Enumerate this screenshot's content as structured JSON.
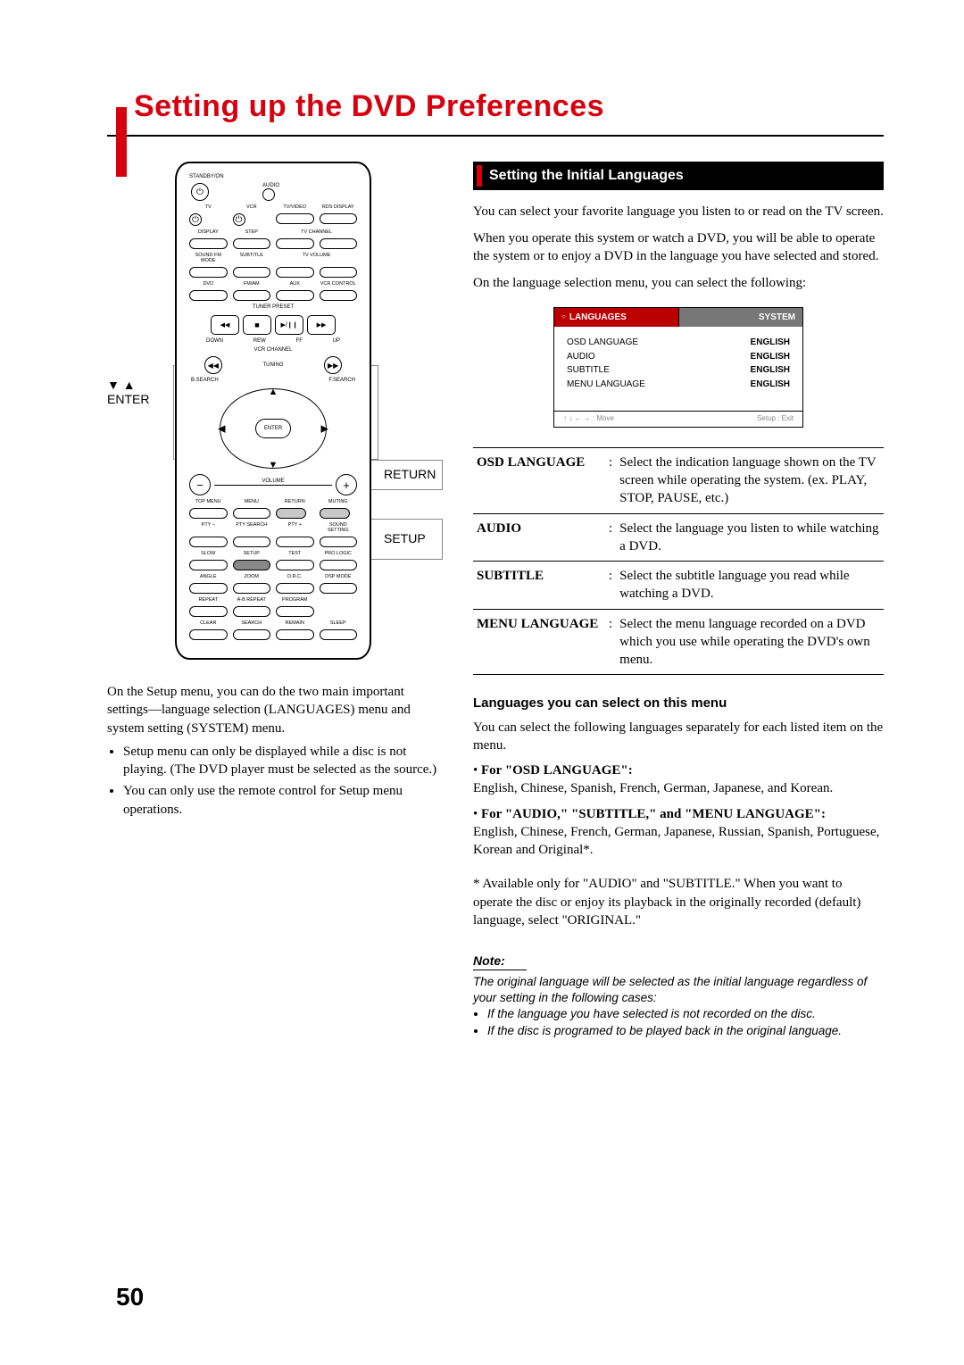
{
  "title": "Setting up the DVD Preferences",
  "page_number": "50",
  "remote_callouts": {
    "enter_arrows": "▼ ▲",
    "enter": "ENTER",
    "return": "RETURN",
    "setup": "SETUP"
  },
  "remote_labels": {
    "standby": "STANDBY/ON",
    "audio": "AUDIO",
    "row1": [
      "TV",
      "VCR",
      "TV/VIDEO",
      "RDS DISPLAY"
    ],
    "row2": [
      "DISPLAY",
      "STEP",
      "TV CHANNEL"
    ],
    "row3": [
      "SOUND FM MODE",
      "SUBTITLE",
      "TV VOLUME"
    ],
    "row4": [
      "DVD",
      "FM/AM",
      "AUX",
      "VCR CONTROL"
    ],
    "tuner": "TUNER PRESET",
    "down": "DOWN",
    "up": "UP",
    "rew": "REW",
    "ff": "FF",
    "vcrch": "VCR CHANNEL",
    "tuning": "TUNING",
    "bsearch": "B.SEARCH",
    "fsearch": "F.SEARCH",
    "enter": "ENTER",
    "volume": "VOLUME",
    "menu_row": [
      "TOP MENU",
      "MENU",
      "RETURN",
      "MUTING"
    ],
    "row5": [
      "PTY –",
      "PTY SEARCH",
      "PTY +",
      "SOUND SETTING"
    ],
    "row6": [
      "SLOW",
      "SETUP",
      "TEST",
      "PRO LOGIC"
    ],
    "row7": [
      "ANGLE",
      "ZOOM",
      "D.R.C.",
      "DSP MODE"
    ],
    "row8": [
      "REPEAT",
      "A-B REPEAT",
      "PROGRAM",
      ""
    ],
    "row9": [
      "CLEAR",
      "SEARCH",
      "REMAIN",
      "SLEEP"
    ]
  },
  "left_text": {
    "p1": "On the Setup menu, you can do the two main important settings—language selection (LANGUAGES) menu and system setting (SYSTEM) menu.",
    "b1": "Setup menu can only be displayed while a disc is not playing. (The DVD player must be selected as the source.)",
    "b2": "You can only use the remote control for Setup menu operations."
  },
  "section_heading": "Setting the Initial Languages",
  "r_p1": "You can select your favorite language you listen to or read on the TV screen.",
  "r_p2": "When you operate this system or watch a DVD, you will be able to operate the system or to enjoy a DVD in the language you have selected and stored.",
  "r_p3": "On the language selection menu, you can select the following:",
  "osd": {
    "tab_lang": "LANGUAGES",
    "tab_sys": "SYSTEM",
    "rows": [
      {
        "k": "OSD LANGUAGE",
        "v": "ENGLISH"
      },
      {
        "k": "AUDIO",
        "v": "ENGLISH"
      },
      {
        "k": "SUBTITLE",
        "v": "ENGLISH"
      },
      {
        "k": "MENU LANGUAGE",
        "v": "ENGLISH"
      }
    ],
    "foot_l": "↑ ↓ ← → : Move",
    "foot_r": "Setup : Exit"
  },
  "defs": [
    {
      "term": "OSD LANGUAGE",
      "desc": "Select the indication language shown on the TV screen while operating the system. (ex. PLAY, STOP, PAUSE, etc.)"
    },
    {
      "term": "AUDIO",
      "desc": "Select the language you listen to while watching a DVD."
    },
    {
      "term": "SUBTITLE",
      "desc": "Select the subtitle language you read while watching a DVD."
    },
    {
      "term": "MENU LANGUAGE",
      "desc": "Select the menu language recorded on a DVD which you use while operating the DVD's own menu."
    }
  ],
  "subhead": "Languages you can select on this menu",
  "sub_p": "You can select the following languages separately for each listed item on the menu.",
  "lang_list": [
    {
      "h": "For \"OSD LANGUAGE\":",
      "t": "English, Chinese, Spanish, French, German, Japanese, and Korean."
    },
    {
      "h": "For \"AUDIO,\" \"SUBTITLE,\" and \"MENU LANGUAGE\":",
      "t": "English, Chinese, French, German, Japanese, Russian, Spanish, Portuguese, Korean and Original*."
    }
  ],
  "asterisk": "* Available only for \"AUDIO\" and \"SUBTITLE.\" When you want to operate the disc or enjoy its playback in the originally recorded (default) language, select \"ORIGINAL.\"",
  "note_hd": "Note:",
  "note_p": "The original language will be selected as the initial language regardless of your setting in the following cases:",
  "note_b1": "If the language you have selected is not recorded on the disc.",
  "note_b2": "If the disc is programed to be played back in the original language."
}
